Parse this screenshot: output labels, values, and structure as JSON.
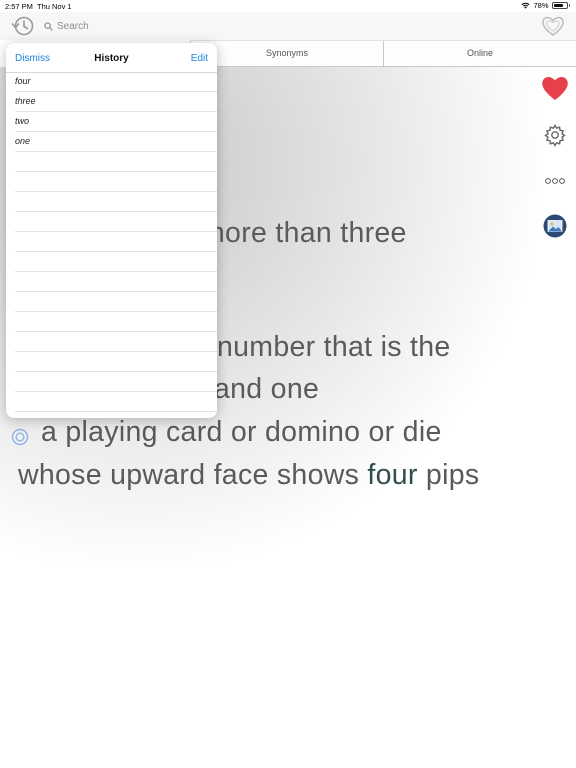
{
  "status_bar": {
    "time": "2:57 PM",
    "date": "Thu Nov 1",
    "battery": "78%",
    "battery_level": 0.78
  },
  "search": {
    "placeholder": "Search",
    "value": ""
  },
  "tabs": [
    {
      "label": "Synonyms"
    },
    {
      "label": "Online"
    }
  ],
  "definition": {
    "line1": "more than three",
    "line2": "number that is the",
    "line3": "and one",
    "line4": "a playing card or domino or die",
    "line5_pre": "whose upward face shows ",
    "line5_hl": "four",
    "line5_post": " pips"
  },
  "history_popover": {
    "dismiss_label": "Dismiss",
    "title": "History",
    "edit_label": "Edit",
    "items": [
      "four",
      "three",
      "two",
      "one"
    ]
  },
  "icons": {
    "history": "history-icon",
    "search": "search-icon",
    "favorites": "heart-outline-icon",
    "favorite": "heart-icon",
    "settings": "gear-icon",
    "more": "ellipsis-icon",
    "image": "image-icon"
  },
  "colors": {
    "accent": "#1a82e0",
    "heart": "#e8404a",
    "highlight": "#2f4f4f"
  }
}
